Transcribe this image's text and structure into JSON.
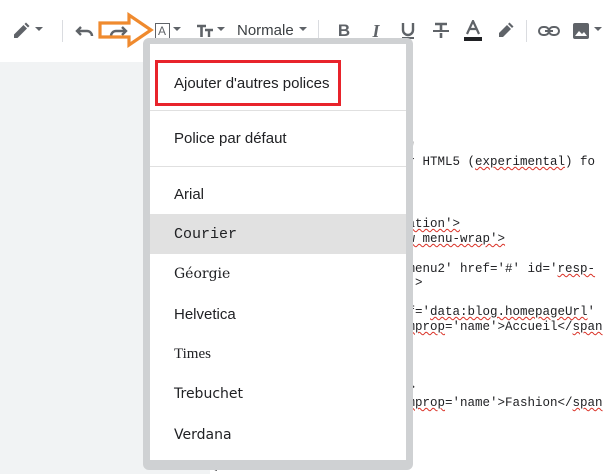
{
  "toolbar": {
    "paragraph_style": "Normale",
    "accent_orange": "#ef8a2e",
    "highlight_red": "#e8232b",
    "text_color_bar": "#202124"
  },
  "editor_lines": [
    {
      "parts": [
        {
          "t": "r\""
        }
      ]
    },
    {
      "parts": [
        {
          "t": "or HTML5 ("
        },
        {
          "t": "experimental",
          "sq": true
        },
        {
          "t": ") fo"
        }
      ]
    },
    {
      "parts": [
        {
          "t": "gation'>",
          "sq": true
        }
      ]
    },
    {
      "parts": [
        {
          "t": "ow menu-wrap'>",
          "sq": true
        }
      ]
    },
    {
      "parts": [
        {
          "t": "-menu2' href='#' id='"
        },
        {
          "t": "resp-",
          "sq": true
        }
      ]
    },
    {
      "parts": [
        {
          "t": "u'>"
        }
      ]
    },
    {
      "parts": [
        {
          "t": "ef='"
        },
        {
          "t": "data:blog.homepageUrl",
          "sq": true
        },
        {
          "t": "'"
        }
      ]
    },
    {
      "parts": [
        {
          "t": "emprop",
          "sq": true
        },
        {
          "t": "='name'>Accueil</"
        },
        {
          "t": "span",
          "sq": true
        }
      ]
    },
    {
      "parts": [
        {
          "t": "'>"
        }
      ]
    },
    {
      "parts": [
        {
          "t": "emprop",
          "sq": true
        },
        {
          "t": "='name'>Fashion</"
        },
        {
          "t": "span",
          "sq": true
        }
      ]
    },
    {
      "parts": [
        {
          "t": "<"
        }
      ]
    }
  ],
  "font_menu": {
    "add_fonts": "Ajouter d'autres polices",
    "default_font": "Police par défaut",
    "fonts": [
      "Arial",
      "Courier",
      "Géorgie",
      "Helvetica",
      "Times",
      "Trebuchet",
      "Verdana"
    ],
    "selected": "Courier"
  }
}
